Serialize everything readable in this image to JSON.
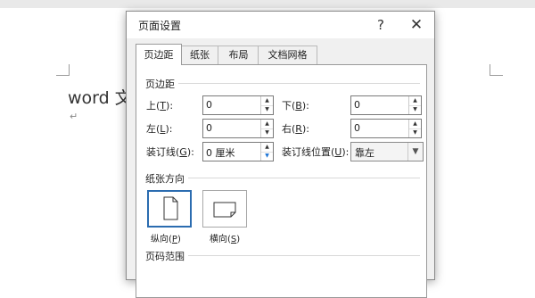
{
  "document": {
    "text": "word 文档",
    "paragraph_mark": "↵"
  },
  "dialog": {
    "title": "页面设置",
    "help_label": "?",
    "close_label": "✕",
    "tabs": [
      {
        "label": "页边距",
        "active": true
      },
      {
        "label": "纸张",
        "active": false
      },
      {
        "label": "布局",
        "active": false
      },
      {
        "label": "文档网格",
        "active": false
      }
    ],
    "margins": {
      "section_title": "页边距",
      "top": {
        "label_main": "上(",
        "accel": "T",
        "label_end": "):",
        "value": "0"
      },
      "bottom": {
        "label_main": "下(",
        "accel": "B",
        "label_end": "):",
        "value": "0"
      },
      "left": {
        "label_main": "左(",
        "accel": "L",
        "label_end": "):",
        "value": "0"
      },
      "right": {
        "label_main": "右(",
        "accel": "R",
        "label_end": "):",
        "value": "0"
      },
      "gutter": {
        "label_main": "装订线(",
        "accel": "G",
        "label_end": "):",
        "value": "0 厘米"
      },
      "gutter_position": {
        "label_main": "装订线位置(",
        "accel": "U",
        "label_end": "):",
        "value": "靠左"
      }
    },
    "orientation": {
      "section_title": "纸张方向",
      "portrait": {
        "label_main": "纵向(",
        "accel": "P",
        "label_end": ")",
        "selected": true
      },
      "landscape": {
        "label_main": "横向(",
        "accel": "S",
        "label_end": ")",
        "selected": false
      }
    },
    "pages": {
      "section_title": "页码范围"
    }
  },
  "colors": {
    "selection_border": "#2b6cb0",
    "dialog_bg": "#f0f0f0",
    "panel_bg": "#ffffff"
  }
}
